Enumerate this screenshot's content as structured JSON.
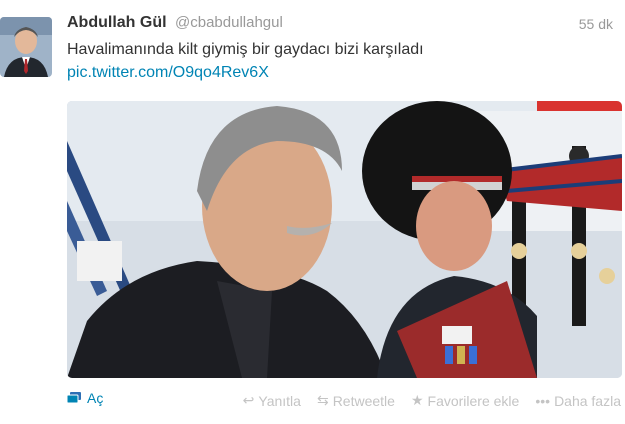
{
  "tweet": {
    "fullname": "Abdullah Gül",
    "username": "@cbabdullahgul",
    "time": "55 dk",
    "text": "Havalimanında kilt giymiş bir gaydacı bizi karşıladı",
    "link": "pic.twitter.com/O9qo4Rev6X"
  },
  "actions": {
    "open": "Aç",
    "reply": "Yanıtla",
    "retweet": "Retweetle",
    "favorite": "Favorilere ekle",
    "more": "Daha fazla"
  },
  "icons": {
    "open": "media-icon",
    "reply": "reply-icon",
    "retweet": "retweet-icon",
    "favorite": "star-icon",
    "more": "more-dots-icon"
  },
  "colors": {
    "link": "#0084b4",
    "muted": "#999999",
    "action": "#c4c4c4"
  }
}
